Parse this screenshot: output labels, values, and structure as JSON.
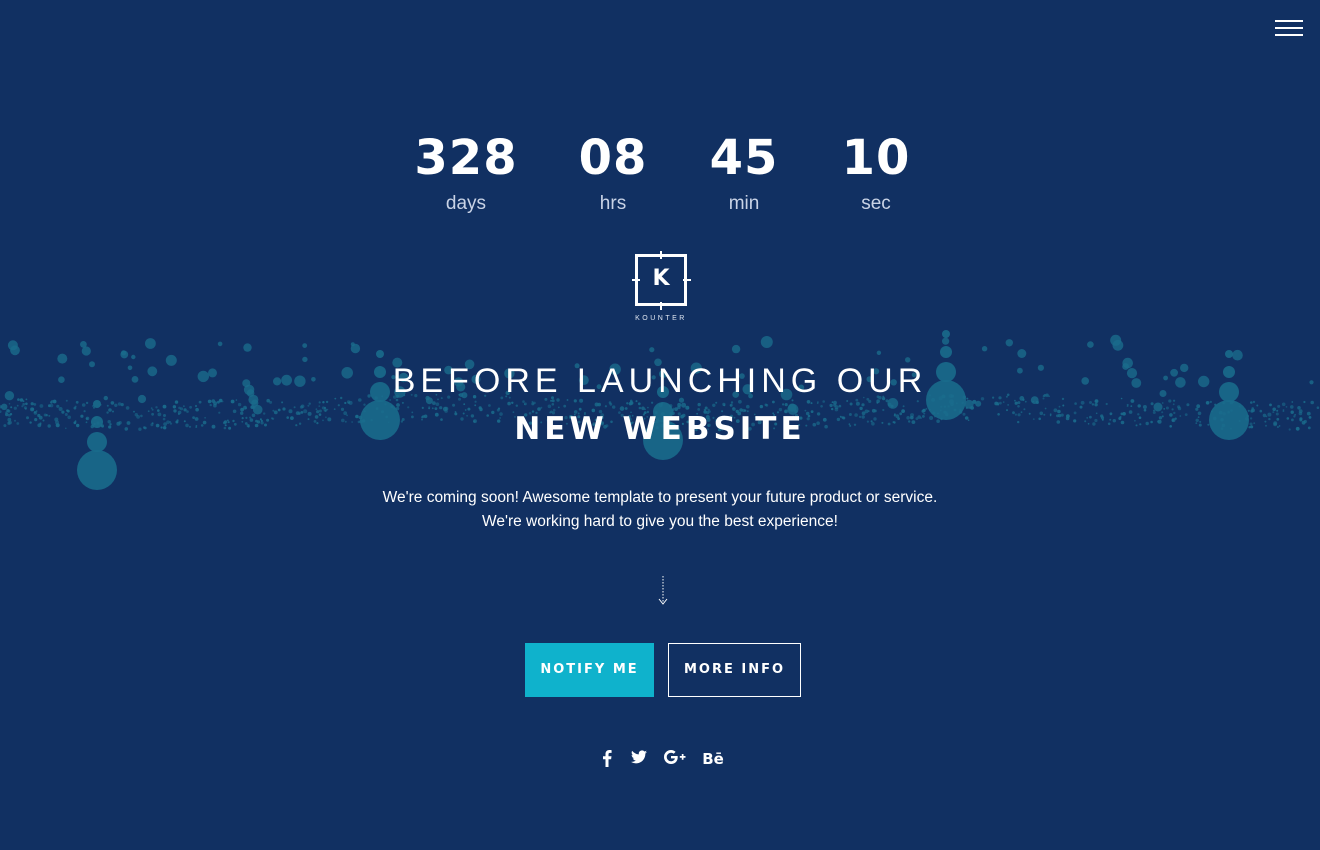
{
  "menu": {
    "icon": "hamburger-menu-icon"
  },
  "countdown": [
    {
      "value": "328",
      "label": "days"
    },
    {
      "value": "08",
      "label": "hrs"
    },
    {
      "value": "45",
      "label": "min"
    },
    {
      "value": "10",
      "label": "sec"
    }
  ],
  "logo": {
    "letter": "K",
    "name": "KOUNTER"
  },
  "hero": {
    "line1": "BEFORE LAUNCHING OUR",
    "line2": "NEW WEBSITE",
    "tagline1": "We're coming soon! Awesome template to present your future product or service.",
    "tagline2": "We're working hard to give you the best experience!"
  },
  "scroll": {
    "icon": "arrow-down-icon"
  },
  "buttons": {
    "notify": "NOTIFY ME",
    "more": "MORE INFO"
  },
  "social": [
    {
      "icon": "facebook-icon",
      "glyph": "f"
    },
    {
      "icon": "twitter-icon",
      "glyph": "twitter"
    },
    {
      "icon": "google-plus-icon",
      "glyph": "G+"
    },
    {
      "icon": "behance-icon",
      "glyph": "Bē"
    }
  ],
  "colors": {
    "background": "#113062",
    "accent": "#0fb2cc",
    "particles": "#1a6b8c",
    "text": "#ffffff"
  }
}
